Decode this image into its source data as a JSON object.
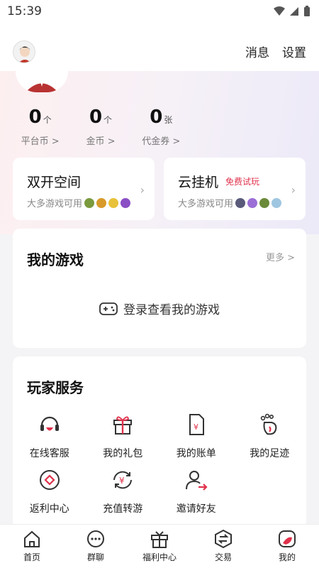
{
  "status_bar": {
    "time": "15:39"
  },
  "header": {
    "messages_label": "消息",
    "settings_label": "设置"
  },
  "stats": [
    {
      "value": "0",
      "unit": "个",
      "label": "平台币 >"
    },
    {
      "value": "0",
      "unit": "个",
      "label": "金币 >"
    },
    {
      "value": "0",
      "unit": "张",
      "label": "代金券 >"
    }
  ],
  "dual_space": {
    "title": "双开空间",
    "subtitle": "大多游戏可用"
  },
  "cloud_host": {
    "title": "云挂机",
    "badge": "免费试玩",
    "subtitle": "大多游戏可用"
  },
  "my_games": {
    "title": "我的游戏",
    "more_label": "更多 >",
    "empty_text": "登录查看我的游戏"
  },
  "services": {
    "title": "玩家服务",
    "items": [
      {
        "label": "在线客服",
        "icon": "headset-icon"
      },
      {
        "label": "我的礼包",
        "icon": "gift-icon"
      },
      {
        "label": "我的账单",
        "icon": "bill-icon"
      },
      {
        "label": "我的足迹",
        "icon": "footprint-icon"
      },
      {
        "label": "返利中心",
        "icon": "rebate-icon"
      },
      {
        "label": "充值转游",
        "icon": "transfer-icon"
      },
      {
        "label": "邀请好友",
        "icon": "invite-icon"
      }
    ]
  },
  "bottom_nav": [
    {
      "label": "首页",
      "icon": "home-icon"
    },
    {
      "label": "群聊",
      "icon": "chat-icon"
    },
    {
      "label": "福利中心",
      "icon": "gift-box-icon"
    },
    {
      "label": "交易",
      "icon": "trade-icon"
    },
    {
      "label": "我的",
      "icon": "profile-icon"
    }
  ],
  "colors": {
    "accent": "#e0314b",
    "text": "#222222"
  }
}
